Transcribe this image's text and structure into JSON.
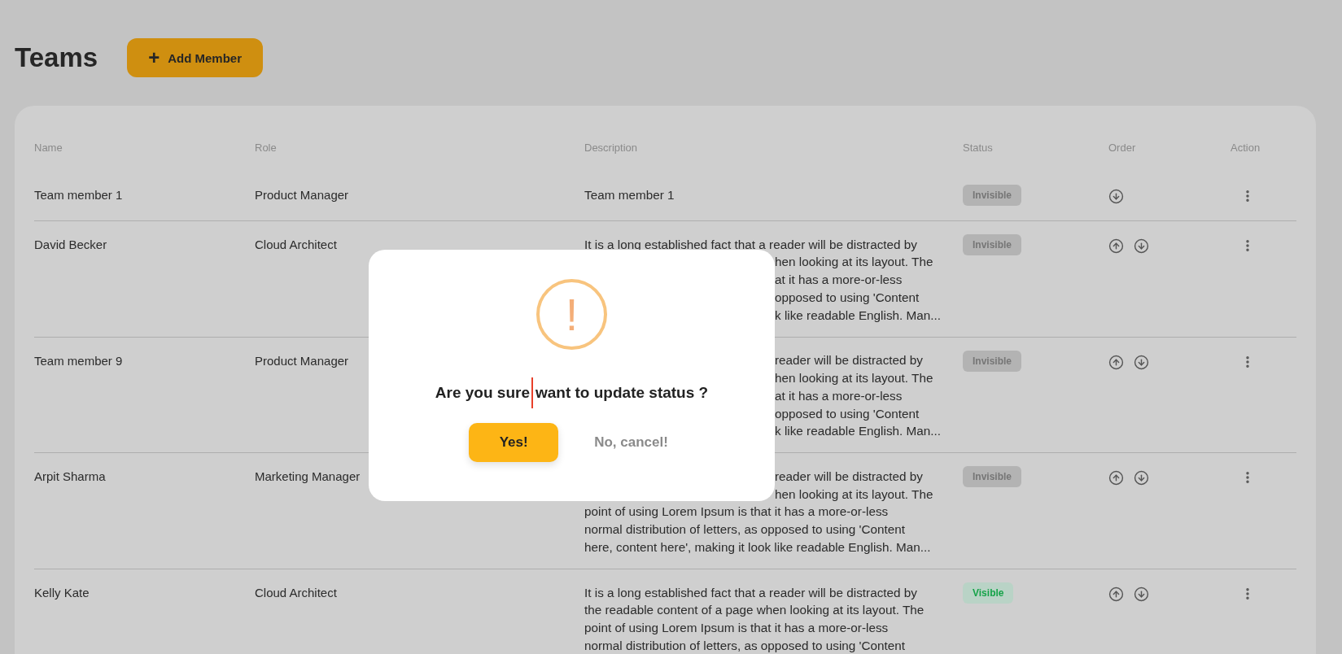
{
  "page": {
    "title": "Teams",
    "add_button": {
      "icon": "+",
      "label": "Add Member"
    }
  },
  "table": {
    "columns": [
      "Name",
      "Role",
      "Description",
      "Status",
      "Order",
      "Action"
    ],
    "rows": [
      {
        "name": "Team member 1",
        "role": "Product Manager",
        "description": [
          {
            "text": "Team member 1",
            "kind": "full"
          }
        ],
        "status": {
          "label": "Invisible",
          "kind": "invisible"
        },
        "order_icons": [
          {
            "kind": "down"
          }
        ]
      },
      {
        "name": "David Becker",
        "role": "Cloud Architect",
        "description": [
          {
            "text": "It is a long established fact that a reader will be distracted by",
            "kind": "full"
          },
          {
            "text": "hen looking at its layout. The",
            "kind": "fragment"
          },
          {
            "text": "at it has a more-or-less",
            "kind": "fragment"
          },
          {
            "text": "opposed to using 'Content",
            "kind": "fragment"
          },
          {
            "text": "k like readable English. Man...",
            "kind": "fragment"
          }
        ],
        "status": {
          "label": "Invisible",
          "kind": "invisible"
        },
        "order_icons": [
          {
            "kind": "up"
          },
          {
            "kind": "down"
          }
        ]
      },
      {
        "name": "Team member 9",
        "role": "Product Manager",
        "description": [
          {
            "text": "reader will be distracted by",
            "kind": "fragment"
          },
          {
            "text": "hen looking at its layout. The",
            "kind": "fragment"
          },
          {
            "text": "at it has a more-or-less",
            "kind": "fragment"
          },
          {
            "text": "opposed to using 'Content",
            "kind": "fragment"
          },
          {
            "text": "k like readable English. Man...",
            "kind": "fragment"
          }
        ],
        "status": {
          "label": "Invisible",
          "kind": "invisible"
        },
        "order_icons": [
          {
            "kind": "up"
          },
          {
            "kind": "down"
          }
        ]
      },
      {
        "name": "Arpit Sharma",
        "role": "Marketing Manager",
        "description": [
          {
            "text": "reader will be distracted by",
            "kind": "fragment"
          },
          {
            "text": "hen looking at its layout. The",
            "kind": "fragment"
          },
          {
            "text": "point of using Lorem Ipsum is that it has a more-or-less",
            "kind": "full"
          },
          {
            "text": "normal distribution of letters, as opposed to using 'Content",
            "kind": "full"
          },
          {
            "text": "here, content here', making it look like readable English. Man...",
            "kind": "full"
          }
        ],
        "status": {
          "label": "Invisible",
          "kind": "invisible"
        },
        "order_icons": [
          {
            "kind": "up"
          },
          {
            "kind": "down"
          }
        ]
      },
      {
        "name": "Kelly Kate",
        "role": "Cloud Architect",
        "description": [
          {
            "text": "It is a long established fact that a reader will be distracted by",
            "kind": "full"
          },
          {
            "text": "the readable content of a page when looking at its layout. The",
            "kind": "full"
          },
          {
            "text": "point of using Lorem Ipsum is that it has a more-or-less",
            "kind": "full"
          },
          {
            "text": "normal distribution of letters, as opposed to using 'Content",
            "kind": "full"
          }
        ],
        "status": {
          "label": "Visible",
          "kind": "visible"
        },
        "order_icons": [
          {
            "kind": "up"
          },
          {
            "kind": "down"
          }
        ]
      }
    ]
  },
  "dialog": {
    "icon": "!",
    "question_before": "Are you sure",
    "question_after": "want to update status ?",
    "confirm": "Yes!",
    "cancel": "No, cancel!"
  }
}
